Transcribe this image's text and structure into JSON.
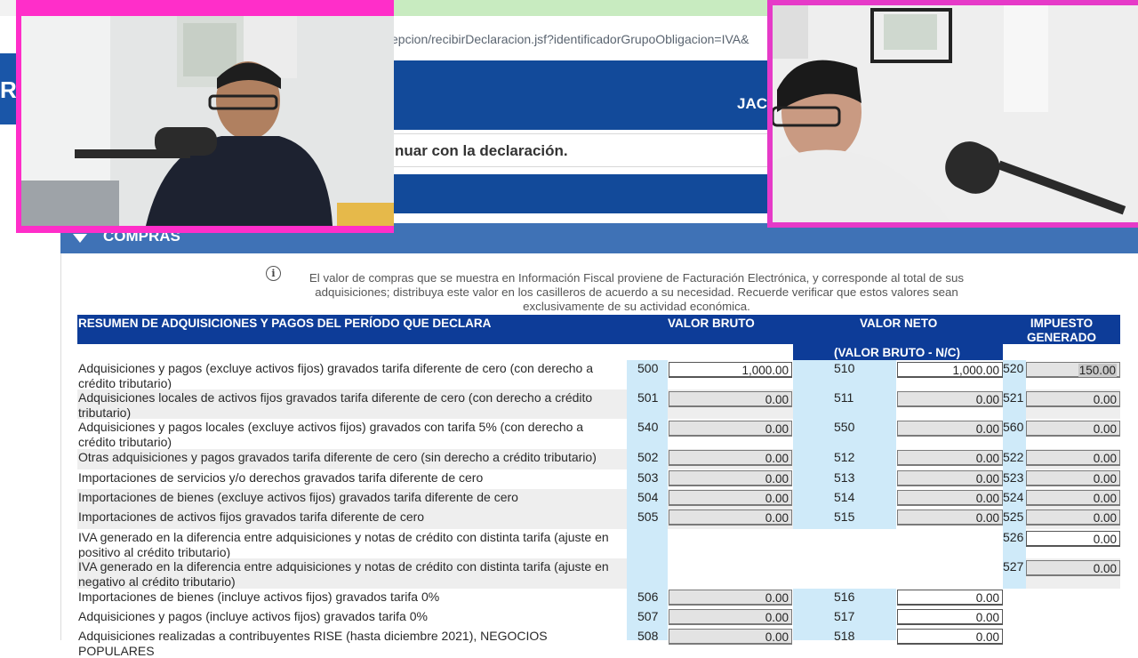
{
  "browser": {
    "url": "epcion/recibirDeclaracion.jsf?identificadorGrupoObligacion=IVA&",
    "header_user": "JAC",
    "message": "nuar con la declaración.",
    "left_edge_text": "R"
  },
  "section": {
    "title": "COMPRAS",
    "info_text": "El valor de compras que se muestra en Información Fiscal proviene de Facturación Electrónica, y corresponde al total de sus adquisiciones; distribuya este valor en los casilleros de acuerdo a su necesidad. Recuerde verificar que estos valores sean exclusivamente de su actividad económica."
  },
  "table": {
    "headers": {
      "summary": "RESUMEN DE ADQUISICIONES Y PAGOS DEL PERÍODO QUE DECLARA",
      "gross": "VALOR BRUTO",
      "net": "VALOR NETO",
      "net_sub": "(VALOR BRUTO - N/C)",
      "tax": "IMPUESTO GENERADO"
    },
    "rows": [
      {
        "label": "Adquisiciones y pagos (excluye activos fijos) gravados tarifa diferente de cero (con derecho a crédito tributario)",
        "c1": "500",
        "v1": "1,000.00",
        "c2": "510",
        "v2": "1,000.00",
        "c3": "520",
        "v3": "150.00"
      },
      {
        "label": "Adquisiciones locales de activos fijos gravados tarifa diferente de cero (con derecho a crédito tributario)",
        "c1": "501",
        "v1": "0.00",
        "c2": "511",
        "v2": "0.00",
        "c3": "521",
        "v3": "0.00"
      },
      {
        "label": "Adquisiciones y pagos locales (excluye activos fijos) gravados con tarifa 5% (con derecho a crédito tributario)",
        "c1": "540",
        "v1": "0.00",
        "c2": "550",
        "v2": "0.00",
        "c3": "560",
        "v3": "0.00"
      },
      {
        "label": "Otras adquisiciones y pagos gravados tarifa diferente de cero (sin derecho a crédito tributario)",
        "c1": "502",
        "v1": "0.00",
        "c2": "512",
        "v2": "0.00",
        "c3": "522",
        "v3": "0.00"
      },
      {
        "label": "Importaciones de servicios y/o derechos gravados tarifa diferente de cero",
        "c1": "503",
        "v1": "0.00",
        "c2": "513",
        "v2": "0.00",
        "c3": "523",
        "v3": "0.00"
      },
      {
        "label": "Importaciones de bienes (excluye activos fijos) gravados tarifa diferente de cero",
        "c1": "504",
        "v1": "0.00",
        "c2": "514",
        "v2": "0.00",
        "c3": "524",
        "v3": "0.00"
      },
      {
        "label": "Importaciones de activos fijos gravados tarifa diferente de cero",
        "c1": "505",
        "v1": "0.00",
        "c2": "515",
        "v2": "0.00",
        "c3": "525",
        "v3": "0.00"
      },
      {
        "label": "IVA generado en la diferencia entre adquisiciones y notas de crédito con distinta tarifa (ajuste en positivo al crédito tributario)",
        "c3": "526",
        "v3": "0.00"
      },
      {
        "label": "IVA generado en la diferencia entre adquisiciones y notas de crédito con distinta tarifa (ajuste en negativo al crédito tributario)",
        "c3": "527",
        "v3": "0.00"
      },
      {
        "label": "Importaciones de bienes (incluye activos fijos) gravados tarifa 0%",
        "c1": "506",
        "v1": "0.00",
        "c2": "516",
        "v2": "0.00"
      },
      {
        "label": "Adquisiciones y pagos (incluye activos fijos) gravados tarifa 0%",
        "c1": "507",
        "v1": "0.00",
        "c2": "517",
        "v2": "0.00"
      },
      {
        "label": "Adquisiciones realizadas a contribuyentes RISE (hasta diciembre 2021), NEGOCIOS POPULARES",
        "c1": "508",
        "v1": "0.00",
        "c2": "518",
        "v2": "0.00"
      }
    ]
  }
}
